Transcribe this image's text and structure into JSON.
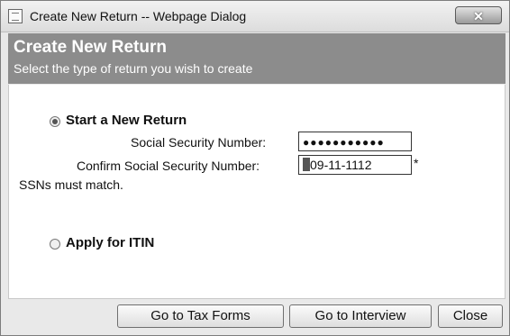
{
  "window": {
    "title": "Create New Return -- Webpage Dialog",
    "close_glyph": "✕",
    "icon": "page-icon"
  },
  "header": {
    "title": "Create New Return",
    "subtitle": "Select the type of return you wish to create"
  },
  "options": {
    "new_return": {
      "label": "Start a New Return",
      "selected": true
    },
    "itin": {
      "label": "Apply for ITIN",
      "selected": false
    }
  },
  "form": {
    "ssn_label": "Social Security Number:",
    "ssn_value": "●●●●●●●●●●●",
    "confirm_label": "Confirm Social Security Number:",
    "confirm_value_first": "2",
    "confirm_value_rest": "09-11-1112",
    "required_marker": "*",
    "validation_message": "SSNs must match."
  },
  "buttons": {
    "tax_forms": "Go to Tax Forms",
    "interview": "Go to Interview",
    "close": "Close"
  },
  "colors": {
    "header_bg": "#8c8c8c",
    "dialog_bg": "#e9e9e9"
  }
}
